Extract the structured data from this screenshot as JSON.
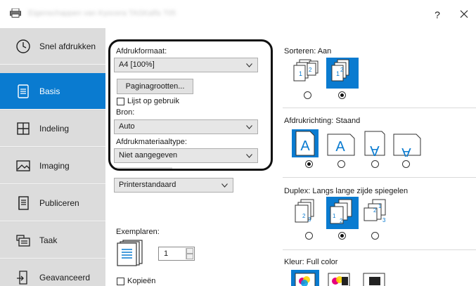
{
  "window": {
    "title": "Eigenschappen van Kyocera TASKalfa 7054ci KX",
    "help_label": "?"
  },
  "sidebar": {
    "items": [
      {
        "label": "Snel afdrukken",
        "icon": "clock-icon"
      },
      {
        "label": "Basis",
        "icon": "document-icon"
      },
      {
        "label": "Indeling",
        "icon": "layout-grid-icon"
      },
      {
        "label": "Imaging",
        "icon": "image-icon"
      },
      {
        "label": "Publiceren",
        "icon": "book-icon"
      },
      {
        "label": "Taak",
        "icon": "job-stack-icon"
      },
      {
        "label": "Geavanceerd",
        "icon": "advanced-icon"
      }
    ],
    "active": "Basis"
  },
  "basic": {
    "print_size_label": "Afdrukformaat:",
    "print_size_value": "A4 [100%]",
    "page_sizes_button": "Paginagrootten...",
    "list_in_use_label": "Lijst op gebruik",
    "source_label": "Bron:",
    "source_value": "Auto",
    "media_type_label": "Afdrukmateriaaltype:",
    "media_type_value": "Niet aangegeven",
    "destination_value": "Printerstandaard",
    "copies_label": "Exemplaren:",
    "copies_value": "1",
    "copies_checkbox_label": "Kopieën"
  },
  "right": {
    "collate_label": "Sorteren: Aan",
    "orientation_label": "Afdrukrichting: Staand",
    "duplex_label": "Duplex: Langs lange zijde spiegelen",
    "color_label": "Kleur: Full color",
    "orientation_glyphs": [
      "A",
      "A",
      "A",
      "A"
    ]
  },
  "colors": {
    "accent": "#0a7bd0",
    "sidebar_bg": "#d7d7d7",
    "highlight_border": "#111111"
  }
}
